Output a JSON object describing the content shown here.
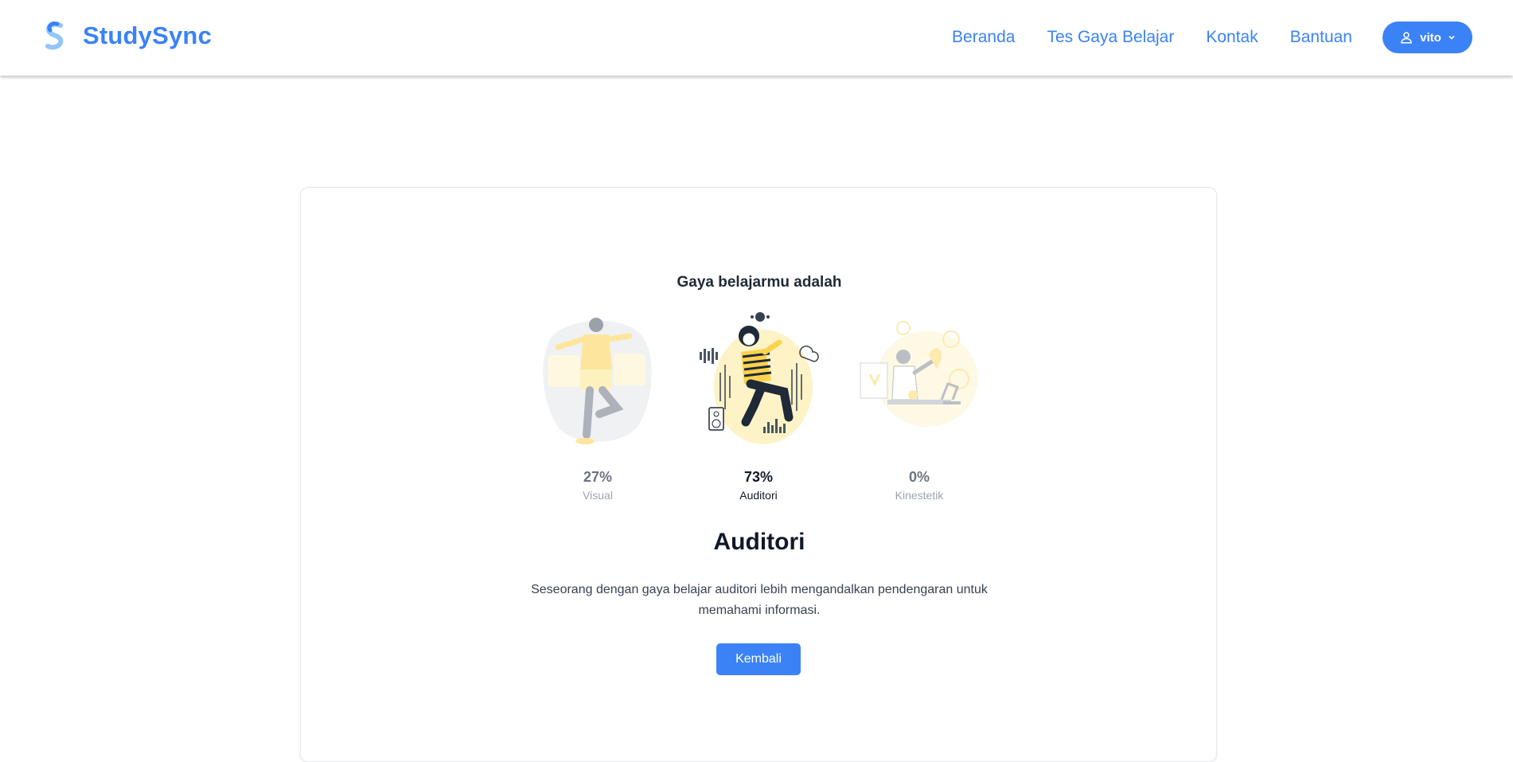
{
  "brand": {
    "name": "StudySync"
  },
  "nav": {
    "links": [
      {
        "label": "Beranda"
      },
      {
        "label": "Tes Gaya Belajar"
      },
      {
        "label": "Kontak"
      },
      {
        "label": "Bantuan"
      }
    ],
    "user": {
      "name": "vito",
      "icon": "user-icon",
      "caret": "chevron-down-icon"
    }
  },
  "result": {
    "heading": "Gaya belajarmu adalah",
    "styles": [
      {
        "percent": "27%",
        "label": "Visual",
        "active": false,
        "icon": "visual-illustration"
      },
      {
        "percent": "73%",
        "label": "Auditori",
        "active": true,
        "icon": "auditory-illustration"
      },
      {
        "percent": "0%",
        "label": "Kinestetik",
        "active": false,
        "icon": "kinesthetic-illustration"
      }
    ],
    "title": "Auditori",
    "description": "Seseorang dengan gaya belajar auditori lebih mengandalkan pendengaran untuk memahami informasi.",
    "button": "Kembali"
  },
  "colors": {
    "accent": "#3b82f6",
    "highlight": "#fde68a"
  }
}
